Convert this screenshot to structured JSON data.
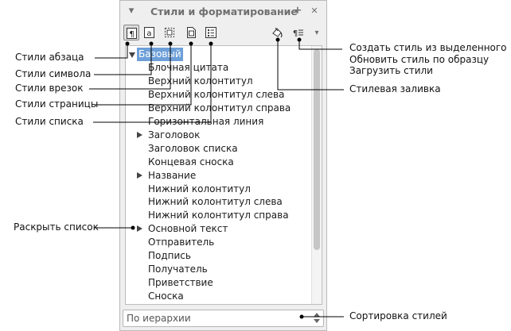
{
  "panel": {
    "title": "Стили и форматирование",
    "controls": {
      "menu": "▾",
      "dock": "+",
      "close": "✕"
    }
  },
  "toolbar": {
    "paragraph": "paragraph-styles-icon",
    "character": "character-styles-icon",
    "frame": "frame-styles-icon",
    "page": "page-styles-icon",
    "list": "list-styles-icon",
    "fill": "fill-format-icon",
    "new_from_selection": "new-style-icon",
    "more": "▾"
  },
  "tree": {
    "items": [
      {
        "label": "Базовый",
        "level": 0,
        "expander": "down",
        "selected": true
      },
      {
        "label": "Блочная цитата",
        "level": 1
      },
      {
        "label": "Верхний колонтитул",
        "level": 1
      },
      {
        "label": "Верхний колонтитул слева",
        "level": 1
      },
      {
        "label": "Верхний колонтитул справа",
        "level": 1
      },
      {
        "label": "Горизонтальная линия",
        "level": 1
      },
      {
        "label": "Заголовок",
        "level": 1,
        "expander": "right"
      },
      {
        "label": "Заголовок списка",
        "level": 1
      },
      {
        "label": "Концевая сноска",
        "level": 1
      },
      {
        "label": "Название",
        "level": 1,
        "expander": "right"
      },
      {
        "label": "Нижний колонтитул",
        "level": 1
      },
      {
        "label": "Нижний колонтитул слева",
        "level": 1
      },
      {
        "label": "Нижний колонтитул справа",
        "level": 1
      },
      {
        "label": "Основной текст",
        "level": 1,
        "expander": "right"
      },
      {
        "label": "Отправитель",
        "level": 1
      },
      {
        "label": "Подпись",
        "level": 1
      },
      {
        "label": "Получатель",
        "level": 1
      },
      {
        "label": "Приветствие",
        "level": 1
      },
      {
        "label": "Сноска",
        "level": 1
      }
    ]
  },
  "sort": {
    "value": "По иерархии"
  },
  "callouts": {
    "paragraph_styles": "Стили абзаца",
    "character_styles": "Стили символа",
    "frame_styles": "Стили врезок",
    "page_styles": "Стили страницы",
    "list_styles": "Стили списка",
    "expand_list": "Раскрыть список",
    "new_from_selection": "Создать стиль из выделенного",
    "update_style": "Обновить стиль по образцу",
    "load_styles": "Загрузить стили",
    "fill_format": "Стилевая заливка",
    "sort_styles": "Сортировка стилей"
  }
}
